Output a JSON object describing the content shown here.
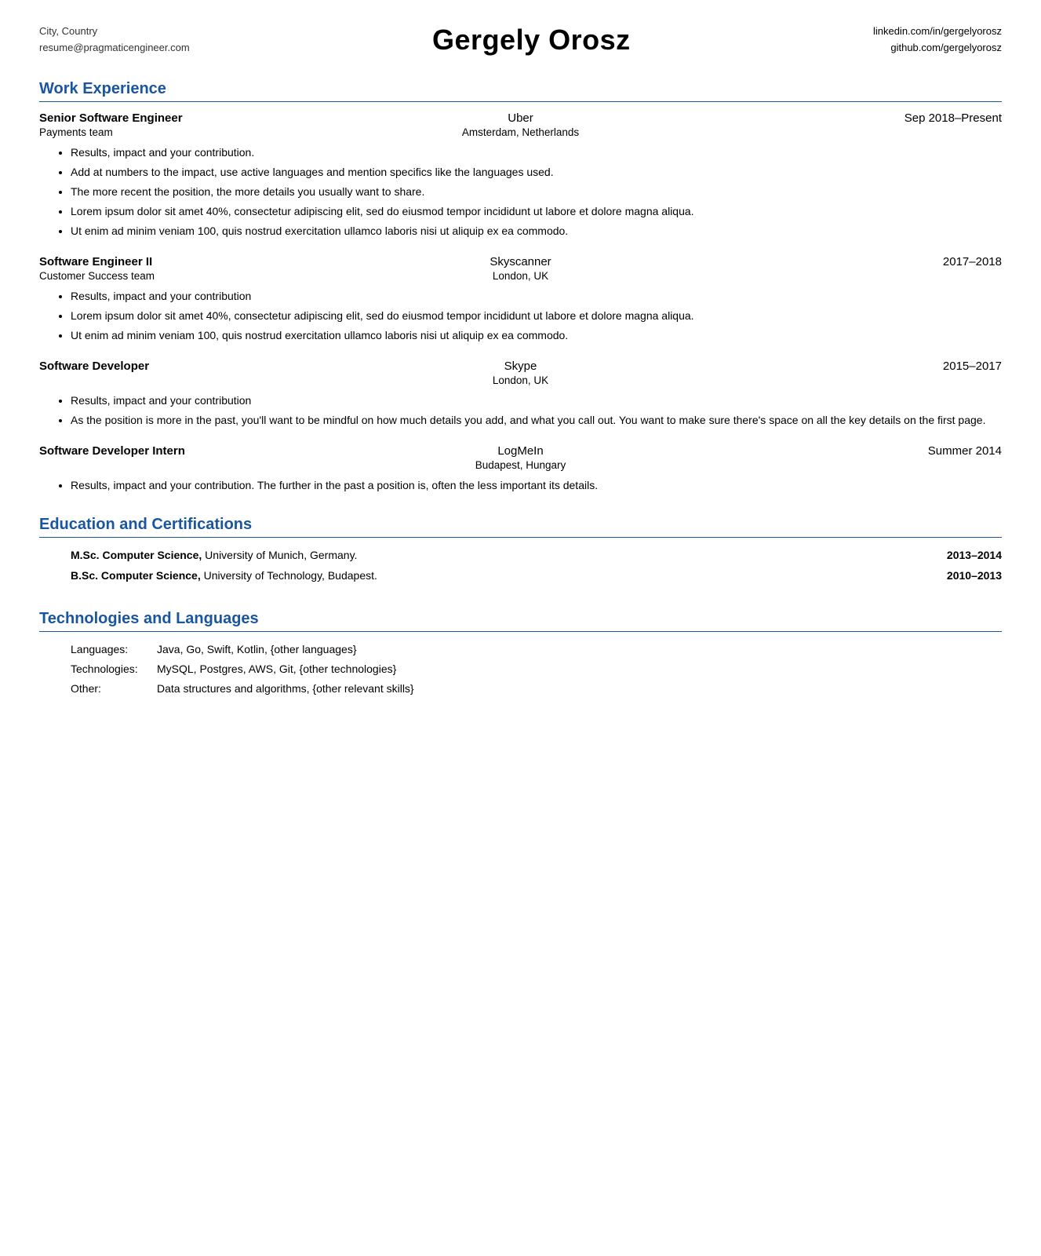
{
  "header": {
    "left_line1": "City, Country",
    "left_line2": "resume@pragmaticengineer.com",
    "name": "Gergely Orosz",
    "right_line1": "linkedin.com/in/gergelyorosz",
    "right_line2": "github.com/gergelyorosz"
  },
  "sections": {
    "work_experience": {
      "title": "Work Experience",
      "jobs": [
        {
          "title": "Senior Software Engineer",
          "company": "Uber",
          "date": "Sep 2018–Present",
          "team": "Payments team",
          "location": "Amsterdam, Netherlands",
          "bullets": [
            "Results, impact and your contribution.",
            "Add at numbers to the impact, use active languages and mention specifics like the languages used.",
            "The more recent the position, the more details you usually want to share.",
            "Lorem ipsum dolor sit amet 40%, consectetur adipiscing elit, sed do eiusmod tempor incididunt ut labore et dolore magna aliqua.",
            "Ut enim ad minim veniam 100, quis nostrud exercitation ullamco laboris nisi ut aliquip ex ea commodo."
          ]
        },
        {
          "title": "Software Engineer II",
          "company": "Skyscanner",
          "date": "2017–2018",
          "team": "Customer Success team",
          "location": "London, UK",
          "bullets": [
            "Results, impact and your contribution",
            "Lorem ipsum dolor sit amet 40%, consectetur adipiscing elit, sed do eiusmod tempor incididunt ut labore et dolore magna aliqua.",
            "Ut enim ad minim veniam 100, quis nostrud exercitation ullamco laboris nisi ut aliquip ex ea commodo."
          ]
        },
        {
          "title": "Software Developer",
          "company": "Skype",
          "date": "2015–2017",
          "team": "",
          "location": "London, UK",
          "bullets": [
            "Results, impact and your contribution",
            "As the position is more in the past, you'll want to be mindful on how much details you add, and what you call out. You want to make sure there's space on all the key details on the first page."
          ]
        },
        {
          "title": "Software Developer Intern",
          "company": "LogMeIn",
          "date": "Summer 2014",
          "team": "",
          "location": "Budapest, Hungary",
          "bullets": [
            "Results, impact and your contribution. The further in the past a position is, often the less important its details."
          ]
        }
      ]
    },
    "education": {
      "title": "Education and Certifications",
      "items": [
        {
          "text": "M.Sc. Computer Science, University of Munich, Germany.",
          "bold_part": "M.Sc. Computer Science,",
          "date": "2013–2014"
        },
        {
          "text": "B.Sc. Computer Science, University of Technology, Budapest.",
          "bold_part": "B.Sc. Computer Science,",
          "date": "2010–2013"
        },
        {
          "text": "",
          "bold_part": "",
          "date": ""
        }
      ]
    },
    "technologies": {
      "title": "Technologies and Languages",
      "items": [
        {
          "label": "Languages:",
          "value": "Java, Go, Swift, Kotlin, {other languages}"
        },
        {
          "label": "Technologies:",
          "value": "MySQL, Postgres, AWS, Git, {other technologies}"
        },
        {
          "label": "Other:",
          "value": "Data structures and algorithms, {other relevant skills}"
        }
      ]
    }
  }
}
